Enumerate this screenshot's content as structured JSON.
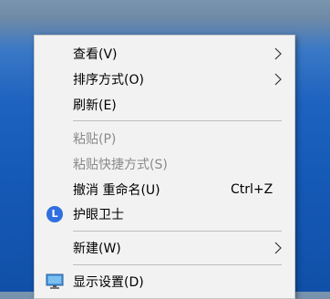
{
  "menu": {
    "view": {
      "label": "查看(V)"
    },
    "sort": {
      "label": "排序方式(O)"
    },
    "refresh": {
      "label": "刷新(E)"
    },
    "paste": {
      "label": "粘贴(P)"
    },
    "paste_shortcut": {
      "label": "粘贴快捷方式(S)"
    },
    "undo_rename": {
      "label": "撤消 重命名(U)",
      "shortcut": "Ctrl+Z"
    },
    "eye_guard": {
      "label": "护眼卫士",
      "icon": "eye-guard-icon"
    },
    "new": {
      "label": "新建(W)"
    },
    "display_settings": {
      "label": "显示设置(D)",
      "icon": "display-icon"
    }
  }
}
